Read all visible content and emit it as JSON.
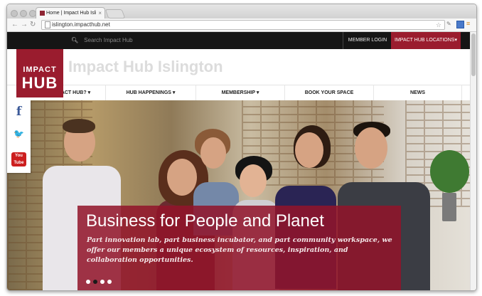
{
  "browser": {
    "tab_title": "Home | Impact Hub Islington",
    "tab_close": "×",
    "url": "islington.impacthub.net"
  },
  "site": {
    "search_placeholder": "Search Impact Hub",
    "member_login": "MEMBER LOGIN",
    "hub_locations": "IMPACT HUB LOCATIONS",
    "logo_line1": "IMPACT",
    "logo_line2": "HUB",
    "site_name": "Impact Hub Islington",
    "nav": [
      {
        "label": "WHAT IS IMPACT HUB?",
        "has_dropdown": true
      },
      {
        "label": "HUB HAPPENINGS",
        "has_dropdown": true
      },
      {
        "label": "MEMBERSHIP",
        "has_dropdown": true
      },
      {
        "label": "BOOK YOUR SPACE",
        "has_dropdown": false
      },
      {
        "label": "NEWS",
        "has_dropdown": false
      }
    ],
    "social": [
      {
        "name": "facebook",
        "glyph": "f",
        "color": "#3b5998"
      },
      {
        "name": "twitter",
        "glyph": "🐦",
        "color": "#33aadd"
      },
      {
        "name": "youtube",
        "glyph": "You Tube",
        "color": "#cc1f1f"
      }
    ],
    "hero": {
      "headline": "Business for People and Planet",
      "description": "Part innovation lab, part business incubator, and part community workspace, we offer our members a unique ecosystem of resources, inspiration, and collaboration opportunities.",
      "slide_count": 4,
      "active_slide": 2
    },
    "colors": {
      "brand": "#9a1c2e",
      "topbar": "#151515"
    }
  }
}
